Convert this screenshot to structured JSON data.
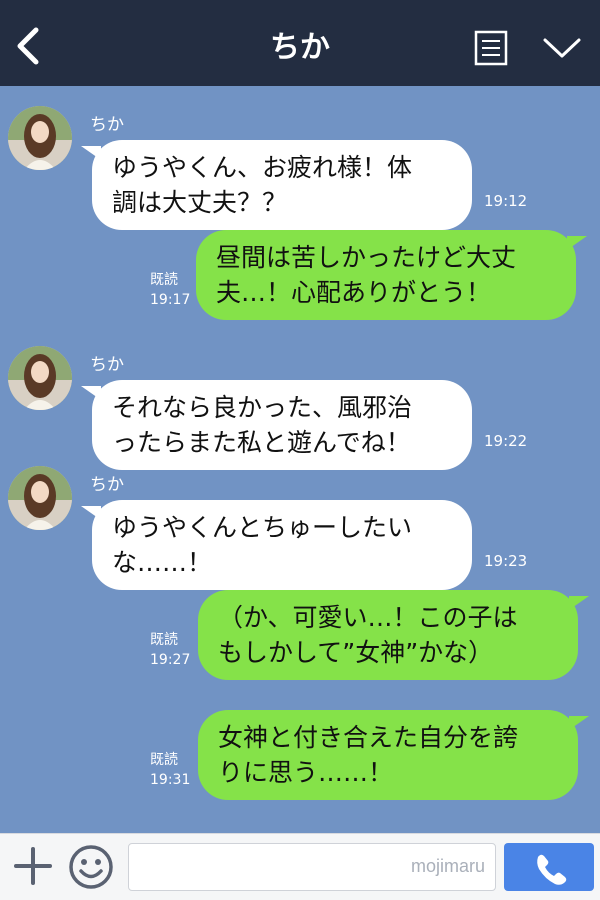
{
  "header": {
    "title": "ちか",
    "back_icon": "chevron-left-icon",
    "menu_icon": "list-icon",
    "expand_icon": "chevron-down-icon"
  },
  "colors": {
    "header_bg": "#232d41",
    "chat_bg": "#7193c4",
    "incoming_bubble": "#ffffff",
    "outgoing_bubble": "#85e249",
    "send_button": "#4a84e6"
  },
  "messages": [
    {
      "direction": "incoming",
      "sender": "ちか",
      "lines": [
        "ゆうやくん、お疲れ様！体",
        "調は大丈夫？？"
      ],
      "time": "19:12"
    },
    {
      "direction": "outgoing",
      "read": "既読",
      "time": "19:17",
      "lines": [
        "昼間は苦しかったけど大丈",
        "夫…！心配ありがとう！"
      ]
    },
    {
      "direction": "incoming",
      "sender": "ちか",
      "lines": [
        "それなら良かった、風邪治",
        "ったらまた私と遊んでね！"
      ],
      "time": "19:22"
    },
    {
      "direction": "incoming",
      "sender": "ちか",
      "lines": [
        "ゆうやくんとちゅーしたい",
        "な……！"
      ],
      "time": "19:23"
    },
    {
      "direction": "outgoing",
      "read": "既読",
      "time": "19:27",
      "lines": [
        "（か、可愛い…！この子は",
        "もしかして”女神”かな）"
      ]
    },
    {
      "direction": "outgoing",
      "read": "既読",
      "time": "19:31",
      "lines": [
        "女神と付き合えた自分を誇",
        "りに思う……！"
      ]
    }
  ],
  "footer": {
    "plus_icon": "plus-icon",
    "emoji_icon": "smiley-icon",
    "input_value": "",
    "watermark": "mojimaru",
    "send_icon": "phone-icon"
  }
}
